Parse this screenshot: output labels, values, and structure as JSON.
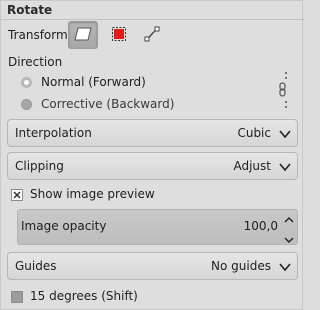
{
  "tool": {
    "title": "Rotate"
  },
  "transform": {
    "label": "Transform:",
    "buttons": [
      {
        "name": "layer",
        "icon": "transform-layer-icon",
        "active": true
      },
      {
        "name": "selection",
        "icon": "transform-selection-icon",
        "active": false
      },
      {
        "name": "path",
        "icon": "transform-path-icon",
        "active": false
      }
    ]
  },
  "direction": {
    "label": "Direction",
    "options": [
      {
        "label": "Normal (Forward)",
        "selected": true
      },
      {
        "label": "Corrective (Backward)",
        "selected": false
      }
    ]
  },
  "interpolation": {
    "label": "Interpolation",
    "value": "Cubic"
  },
  "clipping": {
    "label": "Clipping",
    "value": "Adjust"
  },
  "preview": {
    "label": "Show image preview",
    "checked": true
  },
  "opacity": {
    "label": "Image opacity",
    "value": "100,0"
  },
  "guides": {
    "label": "Guides",
    "value": "No guides"
  },
  "constrain": {
    "label": "15 degrees (Shift)",
    "checked": false
  },
  "colors": {
    "selection_red": "#e21b1b",
    "panel_bg": "#dedede"
  }
}
